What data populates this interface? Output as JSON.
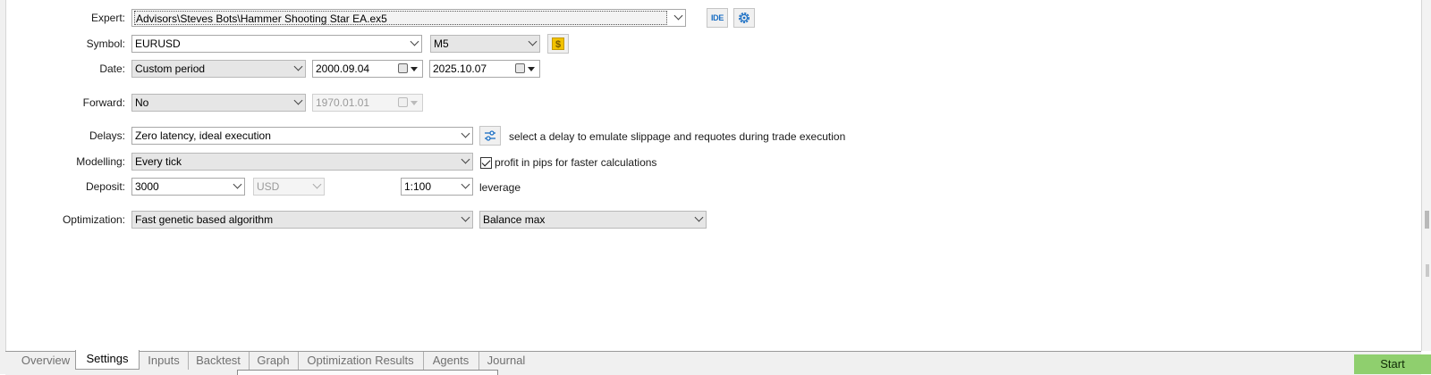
{
  "form": {
    "expert": {
      "label": "Expert:",
      "value": "Advisors\\Steves Bots\\Hammer Shooting Star EA.ex5",
      "ide_label": "IDE",
      "ide_icon": "ide-icon",
      "settings_icon": "gear-icon"
    },
    "symbol": {
      "label": "Symbol:",
      "value": "EURUSD",
      "timeframe": "M5",
      "spec_icon": "dollar-icon",
      "spec_glyph": "$"
    },
    "date": {
      "label": "Date:",
      "period": "Custom period",
      "from": "2000.09.04",
      "to": "2025.10.07"
    },
    "forward": {
      "label": "Forward:",
      "value": "No",
      "date": "1970.01.01"
    },
    "delays": {
      "label": "Delays:",
      "value": "Zero latency, ideal execution",
      "settings_icon": "sliders-icon",
      "hint": "select a delay to emulate slippage and requotes during trade execution"
    },
    "modelling": {
      "label": "Modelling:",
      "value": "Every tick",
      "pips_checked": true,
      "pips_label": "profit in pips for faster calculations"
    },
    "deposit": {
      "label": "Deposit:",
      "amount": "3000",
      "currency": "USD",
      "leverage_value": "1:100",
      "leverage_label": "leverage"
    },
    "optimization": {
      "label": "Optimization:",
      "algorithm": "Fast genetic based algorithm",
      "criterion": "Balance max"
    }
  },
  "tabs": [
    "Overview",
    "Settings",
    "Inputs",
    "Backtest",
    "Graph",
    "Optimization Results",
    "Agents",
    "Journal"
  ],
  "active_tab": "Settings",
  "start_label": "Start",
  "colors": {
    "start_button": "#8fcf6e",
    "accent_icon": "#1b6fc4",
    "dollar_icon": "#f2c200"
  }
}
